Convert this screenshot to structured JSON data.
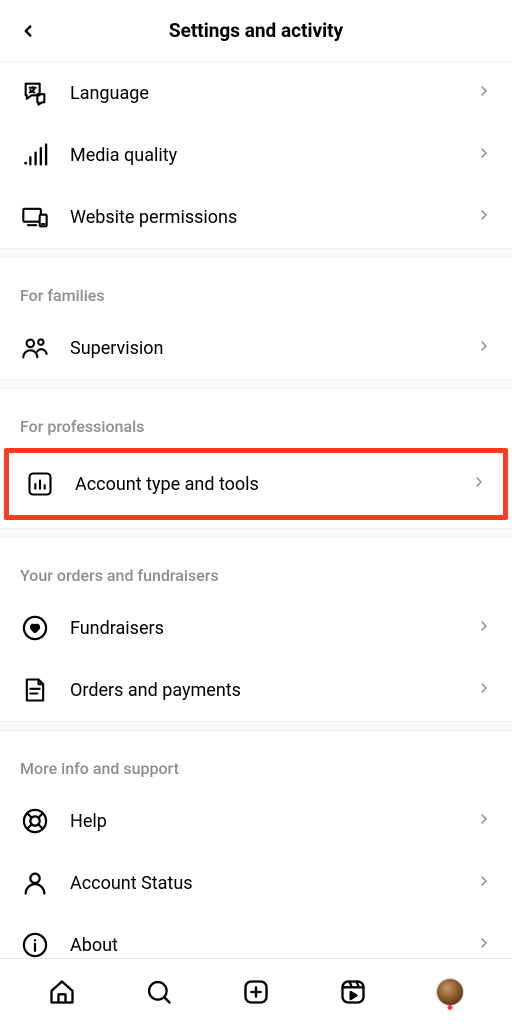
{
  "header": {
    "title": "Settings and activity"
  },
  "sections": {
    "top_items": {
      "language": "Language",
      "media_quality": "Media quality",
      "website_permissions": "Website permissions"
    },
    "families": {
      "heading": "For families",
      "supervision": "Supervision"
    },
    "professionals": {
      "heading": "For professionals",
      "account_type": "Account type and tools"
    },
    "orders": {
      "heading": "Your orders and fundraisers",
      "fundraisers": "Fundraisers",
      "orders_payments": "Orders and payments"
    },
    "info_support": {
      "heading": "More info and support",
      "help": "Help",
      "account_status": "Account Status",
      "about": "About"
    }
  }
}
